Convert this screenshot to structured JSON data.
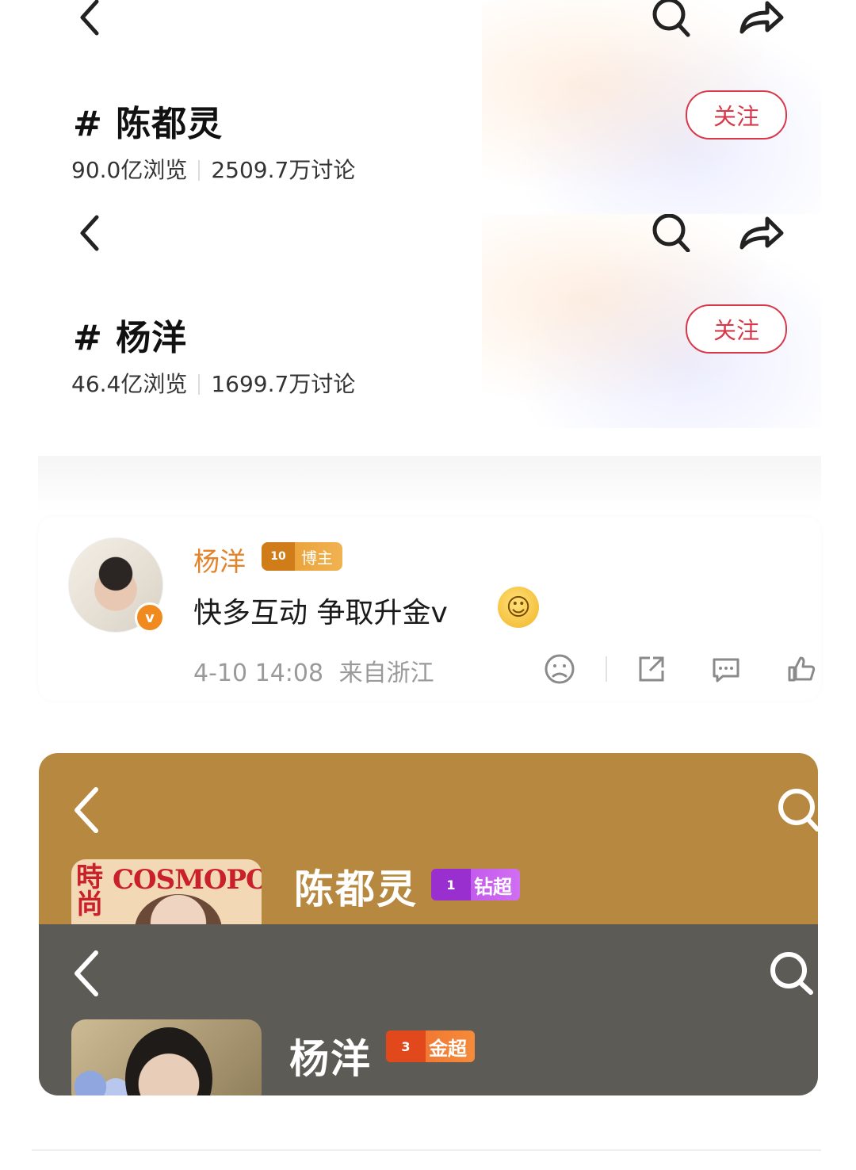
{
  "topics": [
    {
      "title": "# 陈都灵",
      "views": "90.0亿浏览",
      "discussions": "2509.7万讨论",
      "follow_label": "关注"
    },
    {
      "title": "# 杨洋",
      "views": "46.4亿浏览",
      "discussions": "1699.7万讨论",
      "follow_label": "关注"
    }
  ],
  "post": {
    "author": "杨洋",
    "badge_level": "10",
    "badge_label": "博主",
    "text": "快多互动 争取升金v",
    "time": "4-10 14:08",
    "source": "来自浙江",
    "verified_color": "#f08a1e"
  },
  "super_topics": [
    {
      "name": "陈都灵",
      "cover_magazine": "COSMOPOLITAN",
      "cover_cn": "時尚",
      "badge_level": "1",
      "badge_label": "钻超",
      "header_color": "#b7883f"
    },
    {
      "name": "杨洋",
      "badge_level": "3",
      "badge_label": "金超",
      "header_color": "#5c5b55"
    }
  ],
  "icons": {
    "back": "chevron-left-icon",
    "search": "search-icon",
    "share": "share-arrow-icon",
    "dislike": "sad-face-icon",
    "forward": "forward-box-icon",
    "comment": "comment-bubble-icon",
    "like": "thumb-up-icon"
  },
  "colors": {
    "follow_accent": "#d8394a",
    "author_name": "#e3832a"
  }
}
